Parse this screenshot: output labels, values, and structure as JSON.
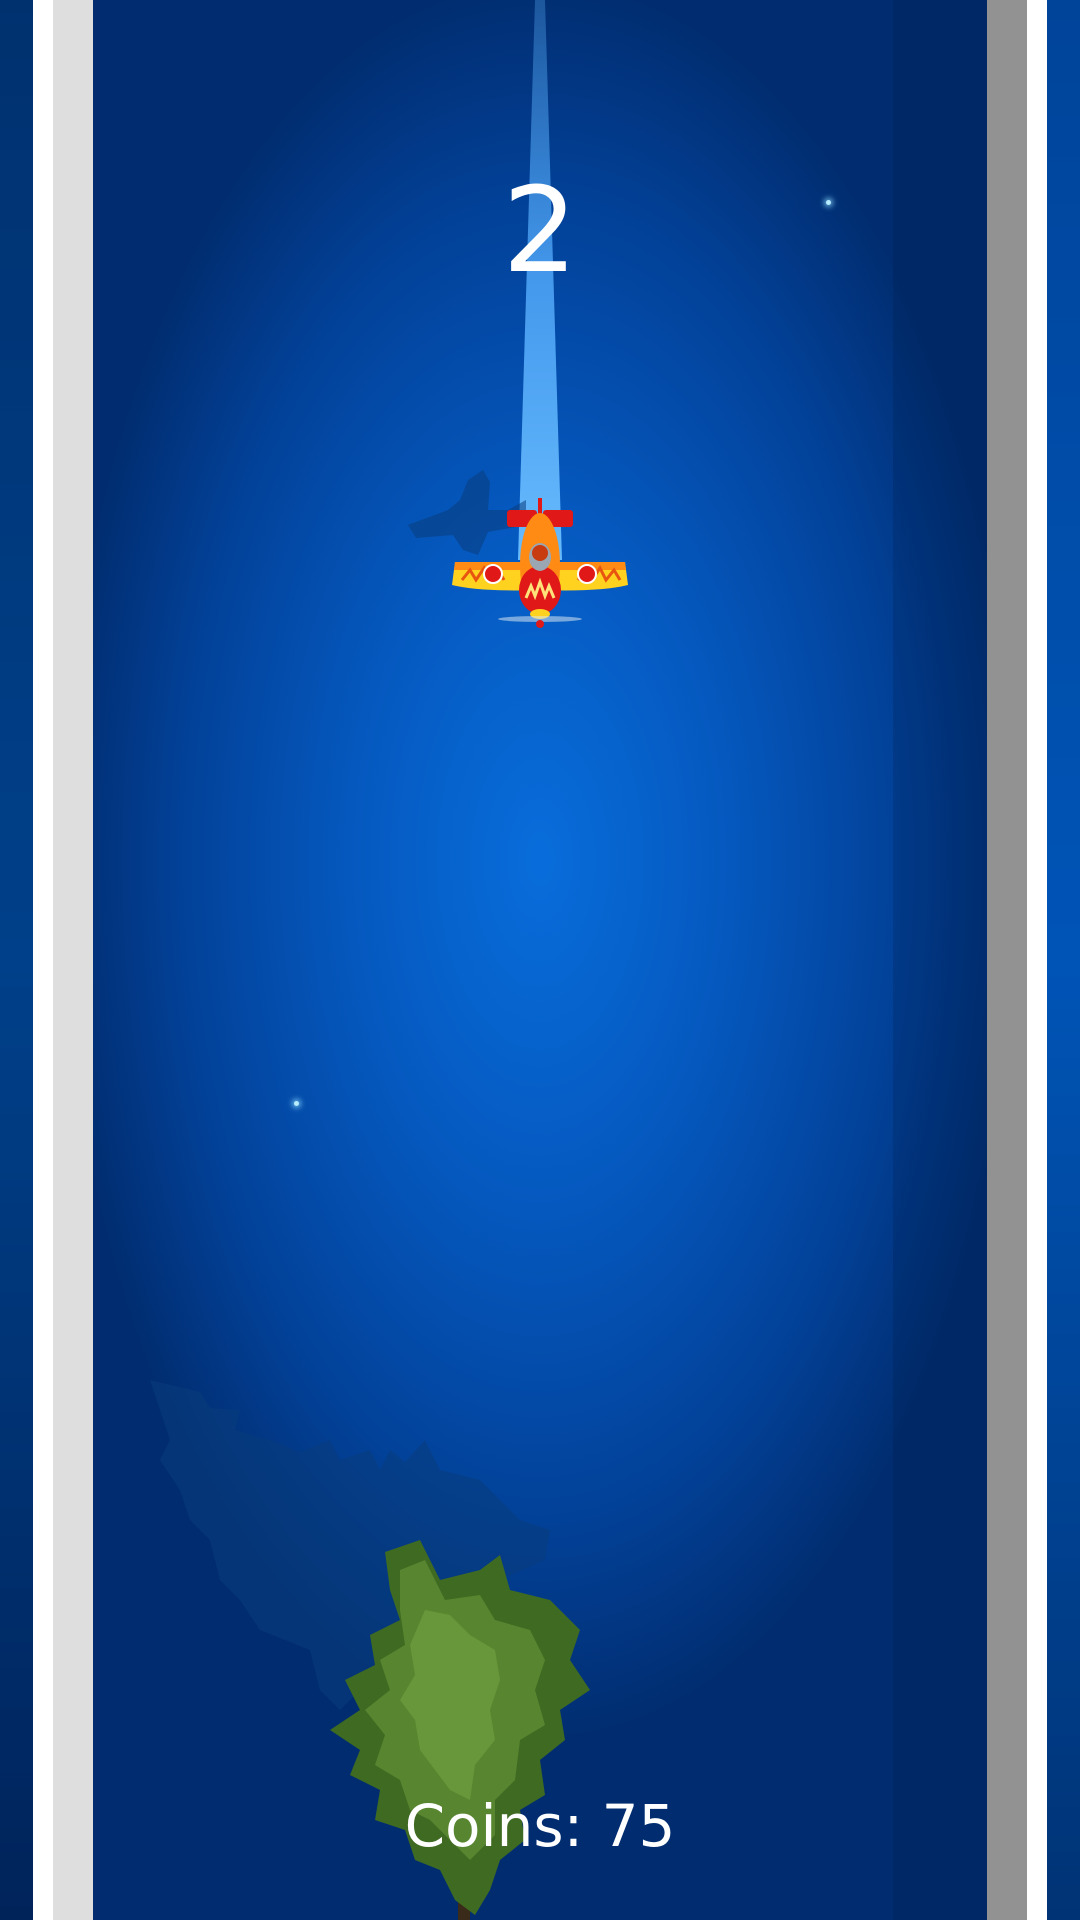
{
  "hud": {
    "score": "2",
    "coins_label": "Coins: 75"
  },
  "icons": {
    "player": "plane-icon",
    "obstacle": "tree-icon",
    "pickup": "sparkle-icon"
  },
  "colors": {
    "sky": "#0563c8",
    "sky_edge": "#012d70",
    "beam": "#5ab2ff",
    "plane_body": "#ff8a14",
    "plane_wing": "#ffd21f",
    "plane_accent": "#e01818",
    "tree": "#4d7a2c",
    "left_stripe": "#dedede",
    "right_stripe": "#929292",
    "hud_text": "#ffffff"
  }
}
